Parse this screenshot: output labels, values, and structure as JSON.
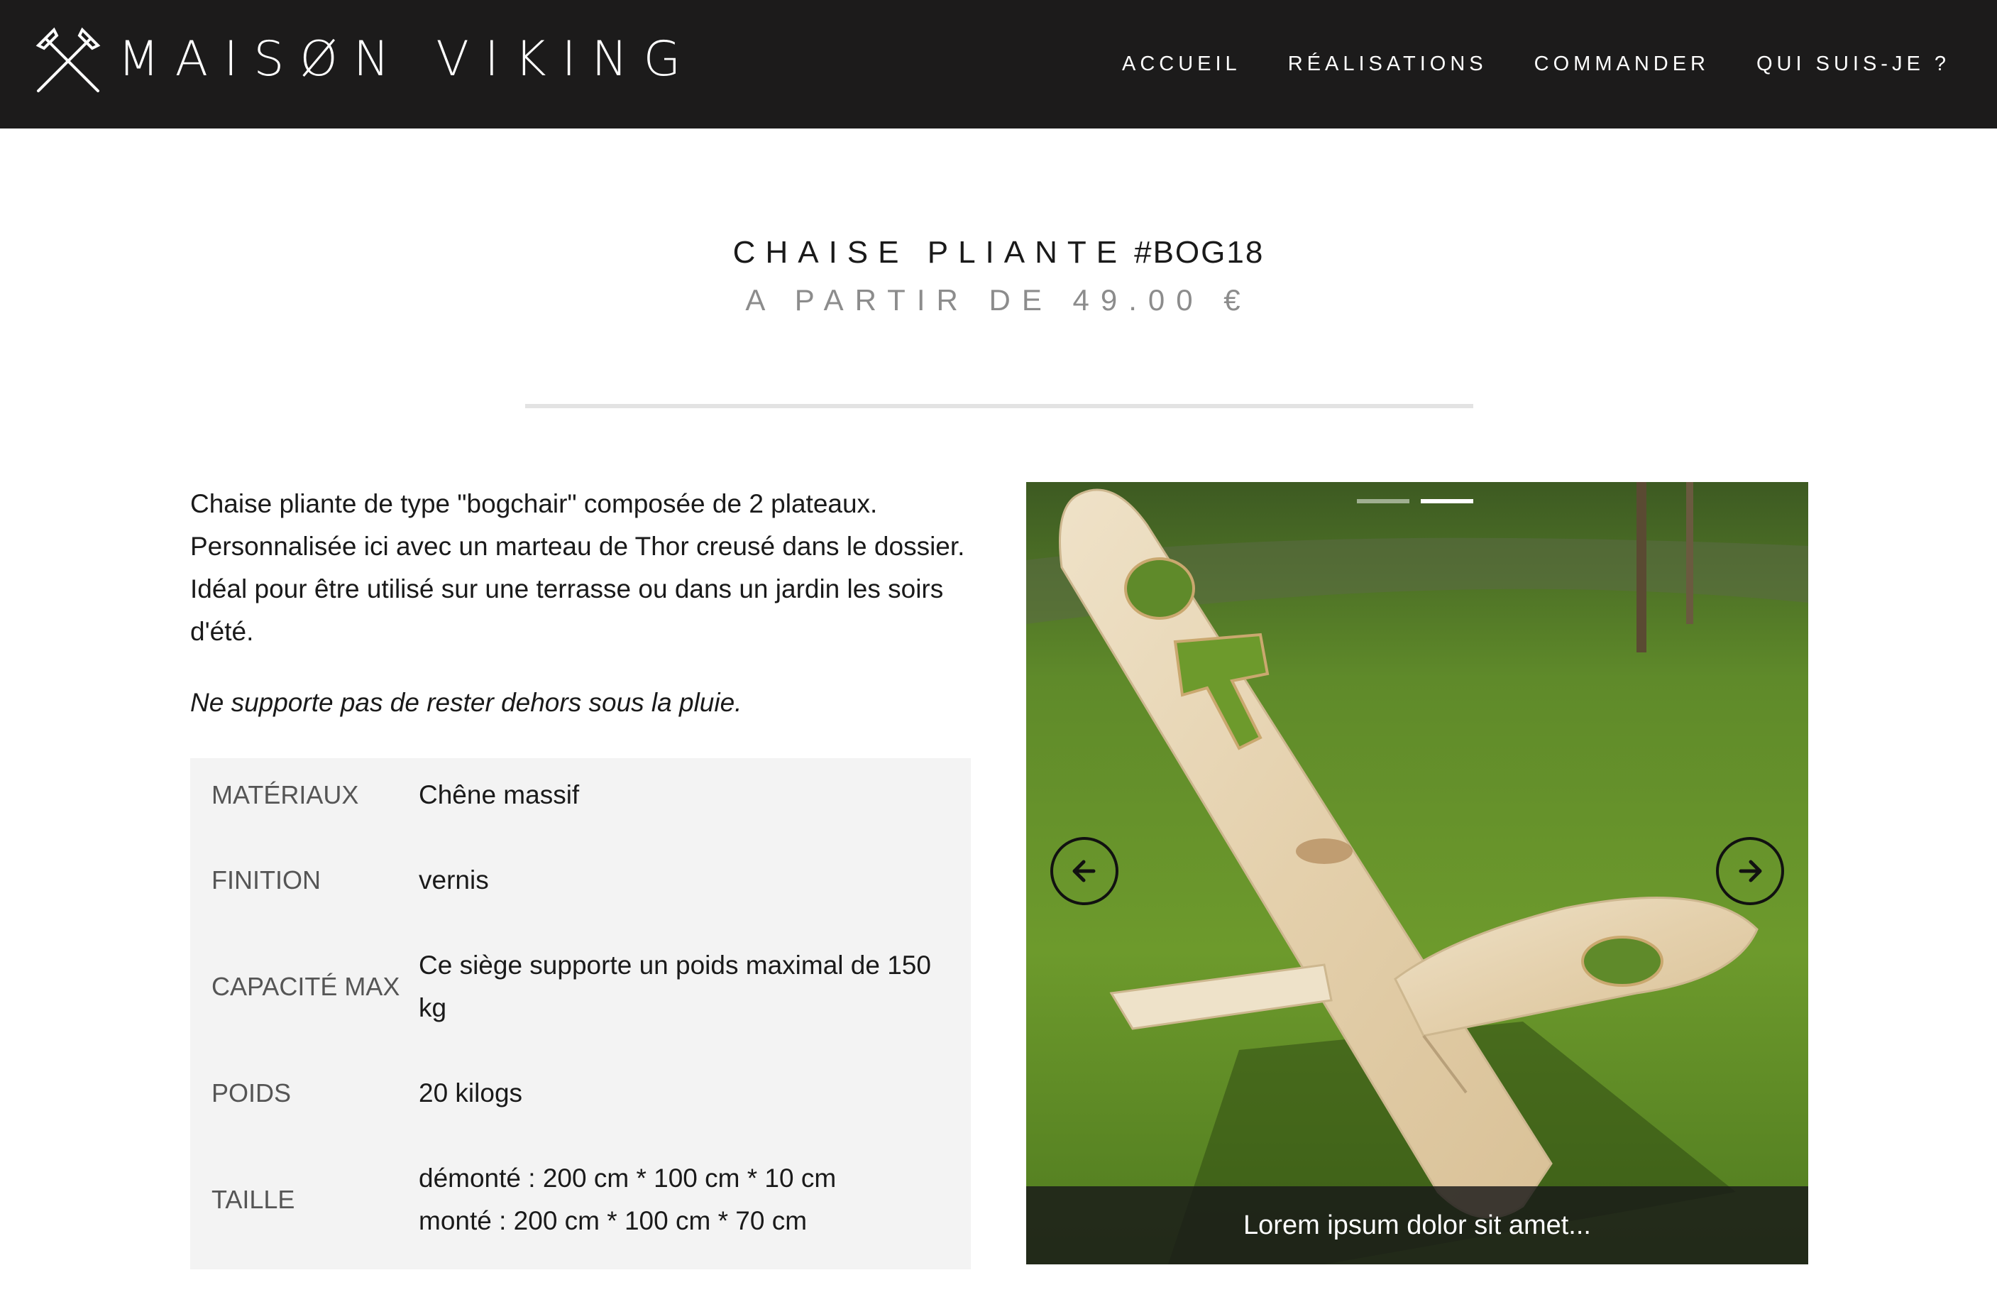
{
  "header": {
    "brand_name": "MAISØN VIKING",
    "logo_icon": "crossed-axes-icon",
    "nav": [
      {
        "label": "ACCUEIL"
      },
      {
        "label": "RÉALISATIONS"
      },
      {
        "label": "COMMANDER"
      },
      {
        "label": "QUI SUIS-JE ?"
      }
    ]
  },
  "product": {
    "title": "CHAISE PLIANTE",
    "code": "#BOG18",
    "price": "A PARTIR DE 49.00 €",
    "description": "Chaise pliante de type \"bogchair\" composée de 2 plateaux. Personnalisée ici avec un marteau de Thor creusé dans le dossier. Idéal pour être utilisé sur une terrasse ou dans un jardin les soirs d'été.",
    "note": "Ne supporte pas de rester dehors sous la pluie.",
    "specs": [
      {
        "label": "MATÉRIAUX",
        "value": "Chêne massif"
      },
      {
        "label": "FINITION",
        "value": "vernis"
      },
      {
        "label": "CAPACITÉ MAX",
        "value": "Ce siège supporte un poids maximal de 150 kg"
      },
      {
        "label": "POIDS",
        "value": "20 kilogs"
      },
      {
        "label": "TAILLE",
        "value_line1": "démonté : 200 cm * 100 cm * 10 cm",
        "value_line2": "monté : 200 cm * 100 cm * 70 cm"
      }
    ]
  },
  "carousel": {
    "caption": "Lorem ipsum dolor sit amet...",
    "slide_count": 2,
    "active_slide": 2,
    "prev_icon": "arrow-left-icon",
    "next_icon": "arrow-right-icon"
  },
  "colors": {
    "header_bg": "#1c1b1b",
    "specs_bg": "#f3f3f3",
    "price_gray": "#8c8c8c"
  }
}
